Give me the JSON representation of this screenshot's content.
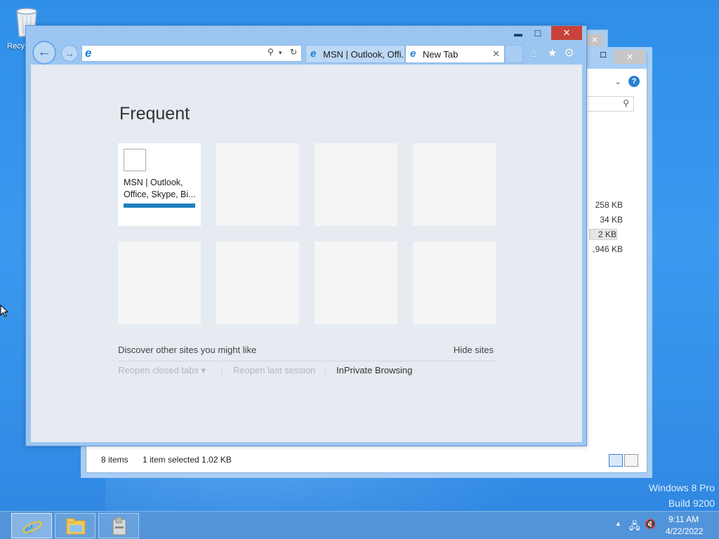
{
  "desktop": {
    "recycle_bin_label": "Recy",
    "watermark_line1": "Windows 8 Pro",
    "watermark_line2": "Build 9200"
  },
  "explorer": {
    "close_glyph": "✕",
    "max_glyph": "☐",
    "sizes": [
      "258 KB",
      "34 KB",
      "2 KB",
      ",946 KB"
    ],
    "status_items": "8 items",
    "status_selected": "1 item selected  1.02 KB"
  },
  "ie": {
    "caption": {
      "min": "▬",
      "max": "☐",
      "close": "✕"
    },
    "address": {
      "value": ""
    },
    "tabs": [
      {
        "label": "MSN | Outlook, Offi...",
        "active": false
      },
      {
        "label": "New Tab",
        "active": true
      }
    ],
    "new_tab_page": {
      "heading": "Frequent",
      "tiles": [
        {
          "title": "MSN | Outlook,\nOffice, Skype, Bi...",
          "filled": true
        },
        {
          "title": "",
          "filled": false
        },
        {
          "title": "",
          "filled": false
        },
        {
          "title": "",
          "filled": false
        },
        {
          "title": "",
          "filled": false
        },
        {
          "title": "",
          "filled": false
        },
        {
          "title": "",
          "filled": false
        },
        {
          "title": "",
          "filled": false
        }
      ],
      "discover_text": "Discover other sites you might like",
      "hide_sites": "Hide sites",
      "reopen_closed_tabs": "Reopen closed tabs ▾",
      "reopen_last_session": "Reopen last session",
      "inprivate": "InPrivate Browsing"
    }
  },
  "taskbar": {
    "time": "9:11 AM",
    "date": "4/22/2022"
  },
  "colors": {
    "desktop": "#2f8fe8",
    "ie_frame": "#9cc6f2",
    "close_red": "#c8423a",
    "tile_bar": "#1b80bf"
  }
}
